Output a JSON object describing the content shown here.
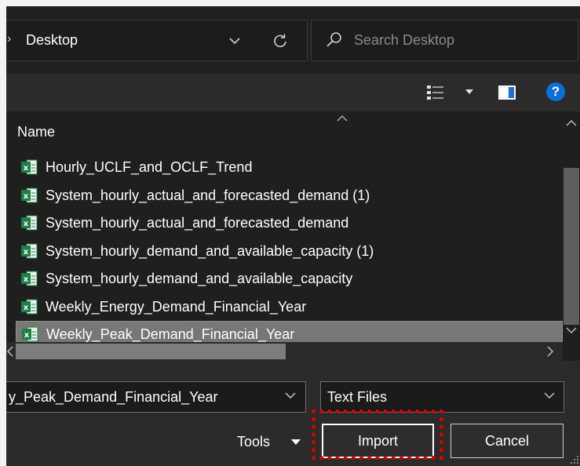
{
  "address_bar": {
    "breadcrumb": "Desktop",
    "separator": "›"
  },
  "search": {
    "placeholder": "Search Desktop"
  },
  "toolbar": {
    "help_label": "?"
  },
  "file_list": {
    "column_header": "Name",
    "files": [
      "Hourly_UCLF_and_OCLF_Trend",
      "System_hourly_actual_and_forecasted_demand (1)",
      "System_hourly_actual_and_forecasted_demand",
      "System_hourly_demand_and_available_capacity (1)",
      "System_hourly_demand_and_available_capacity",
      "Weekly_Energy_Demand_Financial_Year",
      "Weekly_Peak_Demand_Financial_Year"
    ],
    "selected_index": 6
  },
  "bottom": {
    "file_name_value": "y_Peak_Demand_Financial_Year",
    "file_type_value": "Text Files",
    "tools_label": "Tools",
    "import_label": "Import",
    "cancel_label": "Cancel"
  },
  "colors": {
    "highlight": "#e00000",
    "excel_green": "#1e7e45",
    "selected_row": "#777777"
  }
}
